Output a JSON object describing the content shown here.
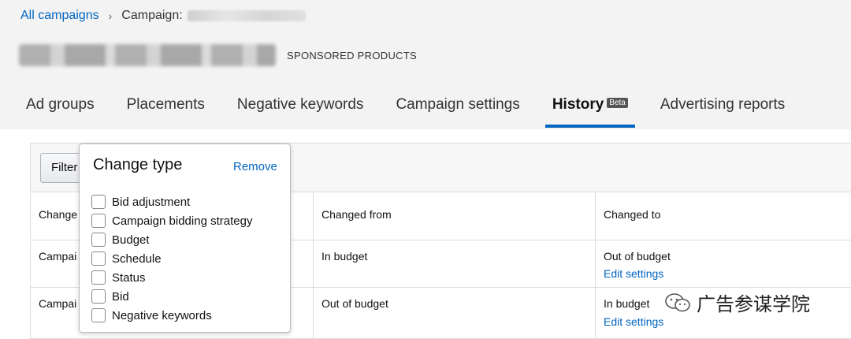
{
  "breadcrumb": {
    "root": "All campaigns",
    "current_prefix": "Campaign:"
  },
  "campaign": {
    "type": "SPONSORED PRODUCTS"
  },
  "tabs": [
    {
      "label": "Ad groups"
    },
    {
      "label": "Placements"
    },
    {
      "label": "Negative keywords"
    },
    {
      "label": "Campaign settings"
    },
    {
      "label": "History",
      "badge": "Beta",
      "active": true
    },
    {
      "label": "Advertising reports"
    }
  ],
  "filter": {
    "button_label": "Filter"
  },
  "table": {
    "headers": [
      "Change",
      "Changed from",
      "Changed to"
    ],
    "rows": [
      {
        "change": "Campai",
        "from": "In budget",
        "to": "Out of budget",
        "action": "Edit settings"
      },
      {
        "change": "Campai",
        "from": "Out of budget",
        "to": "In budget",
        "action": "Edit settings"
      }
    ]
  },
  "dropdown": {
    "title": "Change type",
    "remove_label": "Remove",
    "options": [
      {
        "label": "Bid adjustment",
        "checked": false
      },
      {
        "label": "Campaign bidding strategy",
        "checked": false
      },
      {
        "label": "Budget",
        "checked": false
      },
      {
        "label": "Schedule",
        "checked": false
      },
      {
        "label": "Status",
        "checked": false
      },
      {
        "label": "Bid",
        "checked": false
      },
      {
        "label": "Negative keywords",
        "checked": false
      }
    ]
  },
  "watermark": {
    "text": "广告参谋学院"
  },
  "colors": {
    "accent": "#0066c0",
    "header_bg": "#f3f3f3"
  }
}
